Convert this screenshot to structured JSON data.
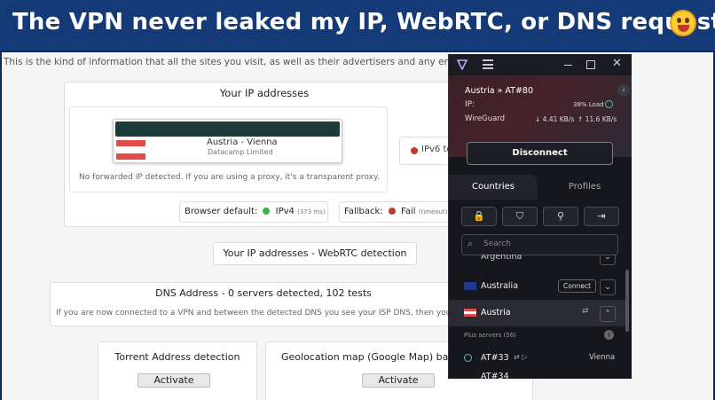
{
  "banner": {
    "title": "The VPN never leaked my IP, WebRTC, or DNS requests",
    "emoji": "grinning-face-icon"
  },
  "page": {
    "intro": "This is the kind of information that all the sites you visit, as well as their advertisers and any embedde",
    "ip_section": {
      "title": "Your IP addresses",
      "location": "Austria - Vienna",
      "isp": "Datacamp Limited",
      "forward_note": "No forwarded IP detected. If you are using a proxy, it's a transparent proxy.",
      "ipv6_label": "IPv6 te",
      "browser_default_label": "Browser default:",
      "ipv4_label": "IPv4",
      "ipv4_time": "(373 ms)",
      "fallback_label": "Fallback:",
      "fail_label": "Fail",
      "fail_note": "(timeout)"
    },
    "webrtc": {
      "title": "Your IP addresses - WebRTC detection"
    },
    "dns": {
      "title": "DNS Address - 0 servers detected, 102 tests",
      "note": "If you are now connected to a VPN and between the detected DNS you see your ISP DNS, then you"
    },
    "torrent": {
      "title": "Torrent Address detection",
      "button": "Activate"
    },
    "geo": {
      "title": "Geolocation map (Google Map) bas",
      "button": "Activate"
    }
  },
  "vpn": {
    "server": "Austria » AT#80",
    "ip_label": "IP:",
    "load": "38% Load",
    "protocol": "WireGuard",
    "down": "↓ 4.41 KB/s",
    "up": "↑ 11.6 KB/s",
    "disconnect": "Disconnect",
    "tabs": {
      "countries": "Countries",
      "profiles": "Profiles"
    },
    "search_placeholder": "Search",
    "countries": [
      {
        "name": "Argentina"
      },
      {
        "name": "Australia",
        "action": "Connect"
      },
      {
        "name": "Austria"
      }
    ],
    "plus_label": "Plus servers (56)",
    "servers": [
      {
        "name": "AT#33",
        "city": "Vienna"
      },
      {
        "name": "AT#34"
      }
    ],
    "colors": {
      "accent": "#6d4aff",
      "background": "#16171d"
    }
  }
}
